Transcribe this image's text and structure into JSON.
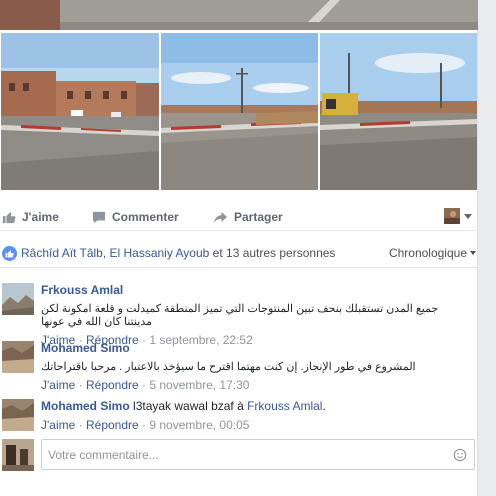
{
  "actions": {
    "like": "J'aime",
    "comment": "Commenter",
    "share": "Partager"
  },
  "likes": {
    "names": "Râchîd Aït Tâlb, El Hassaniy Ayoub",
    "rest": " et 13 autres personnes",
    "sort": "Chronologique"
  },
  "comments": [
    {
      "name": "Frkouss Amlal",
      "text": "جميع المدن تستقبلك بنحف تبين المنتوجات التي تميز المنطقة كميدلت و قلعة امكونة لكن مدينتنا كان الله في عونها",
      "like": "J'aime",
      "reply": "Répondre",
      "date": "1 septembre, 22:52"
    },
    {
      "name": "Mohamed Simo",
      "text": "المشروع في طور الإنجاز. إن كنت مهتما اقترح ما سيؤخذ بالاعتبار . مرحبا باقتراحاتك",
      "like": "J'aime",
      "reply": "Répondre",
      "date": "5 novembre, 17:30"
    },
    {
      "name": "Mohamed Simo",
      "text": "l3tayak wawal bzaf à ",
      "mention": "Frkouss Amlal",
      "after": ".",
      "like": "J'aime",
      "reply": "Répondre",
      "date": "9 novembre, 00:05"
    }
  ],
  "composer": {
    "placeholder": "Votre commentaire..."
  },
  "colors": {
    "link": "#385898",
    "like_blue": "#5890ff"
  },
  "icons": [
    "thumb-up-icon",
    "comment-icon",
    "share-icon",
    "smiley-icon",
    "chevron-down-icon"
  ]
}
